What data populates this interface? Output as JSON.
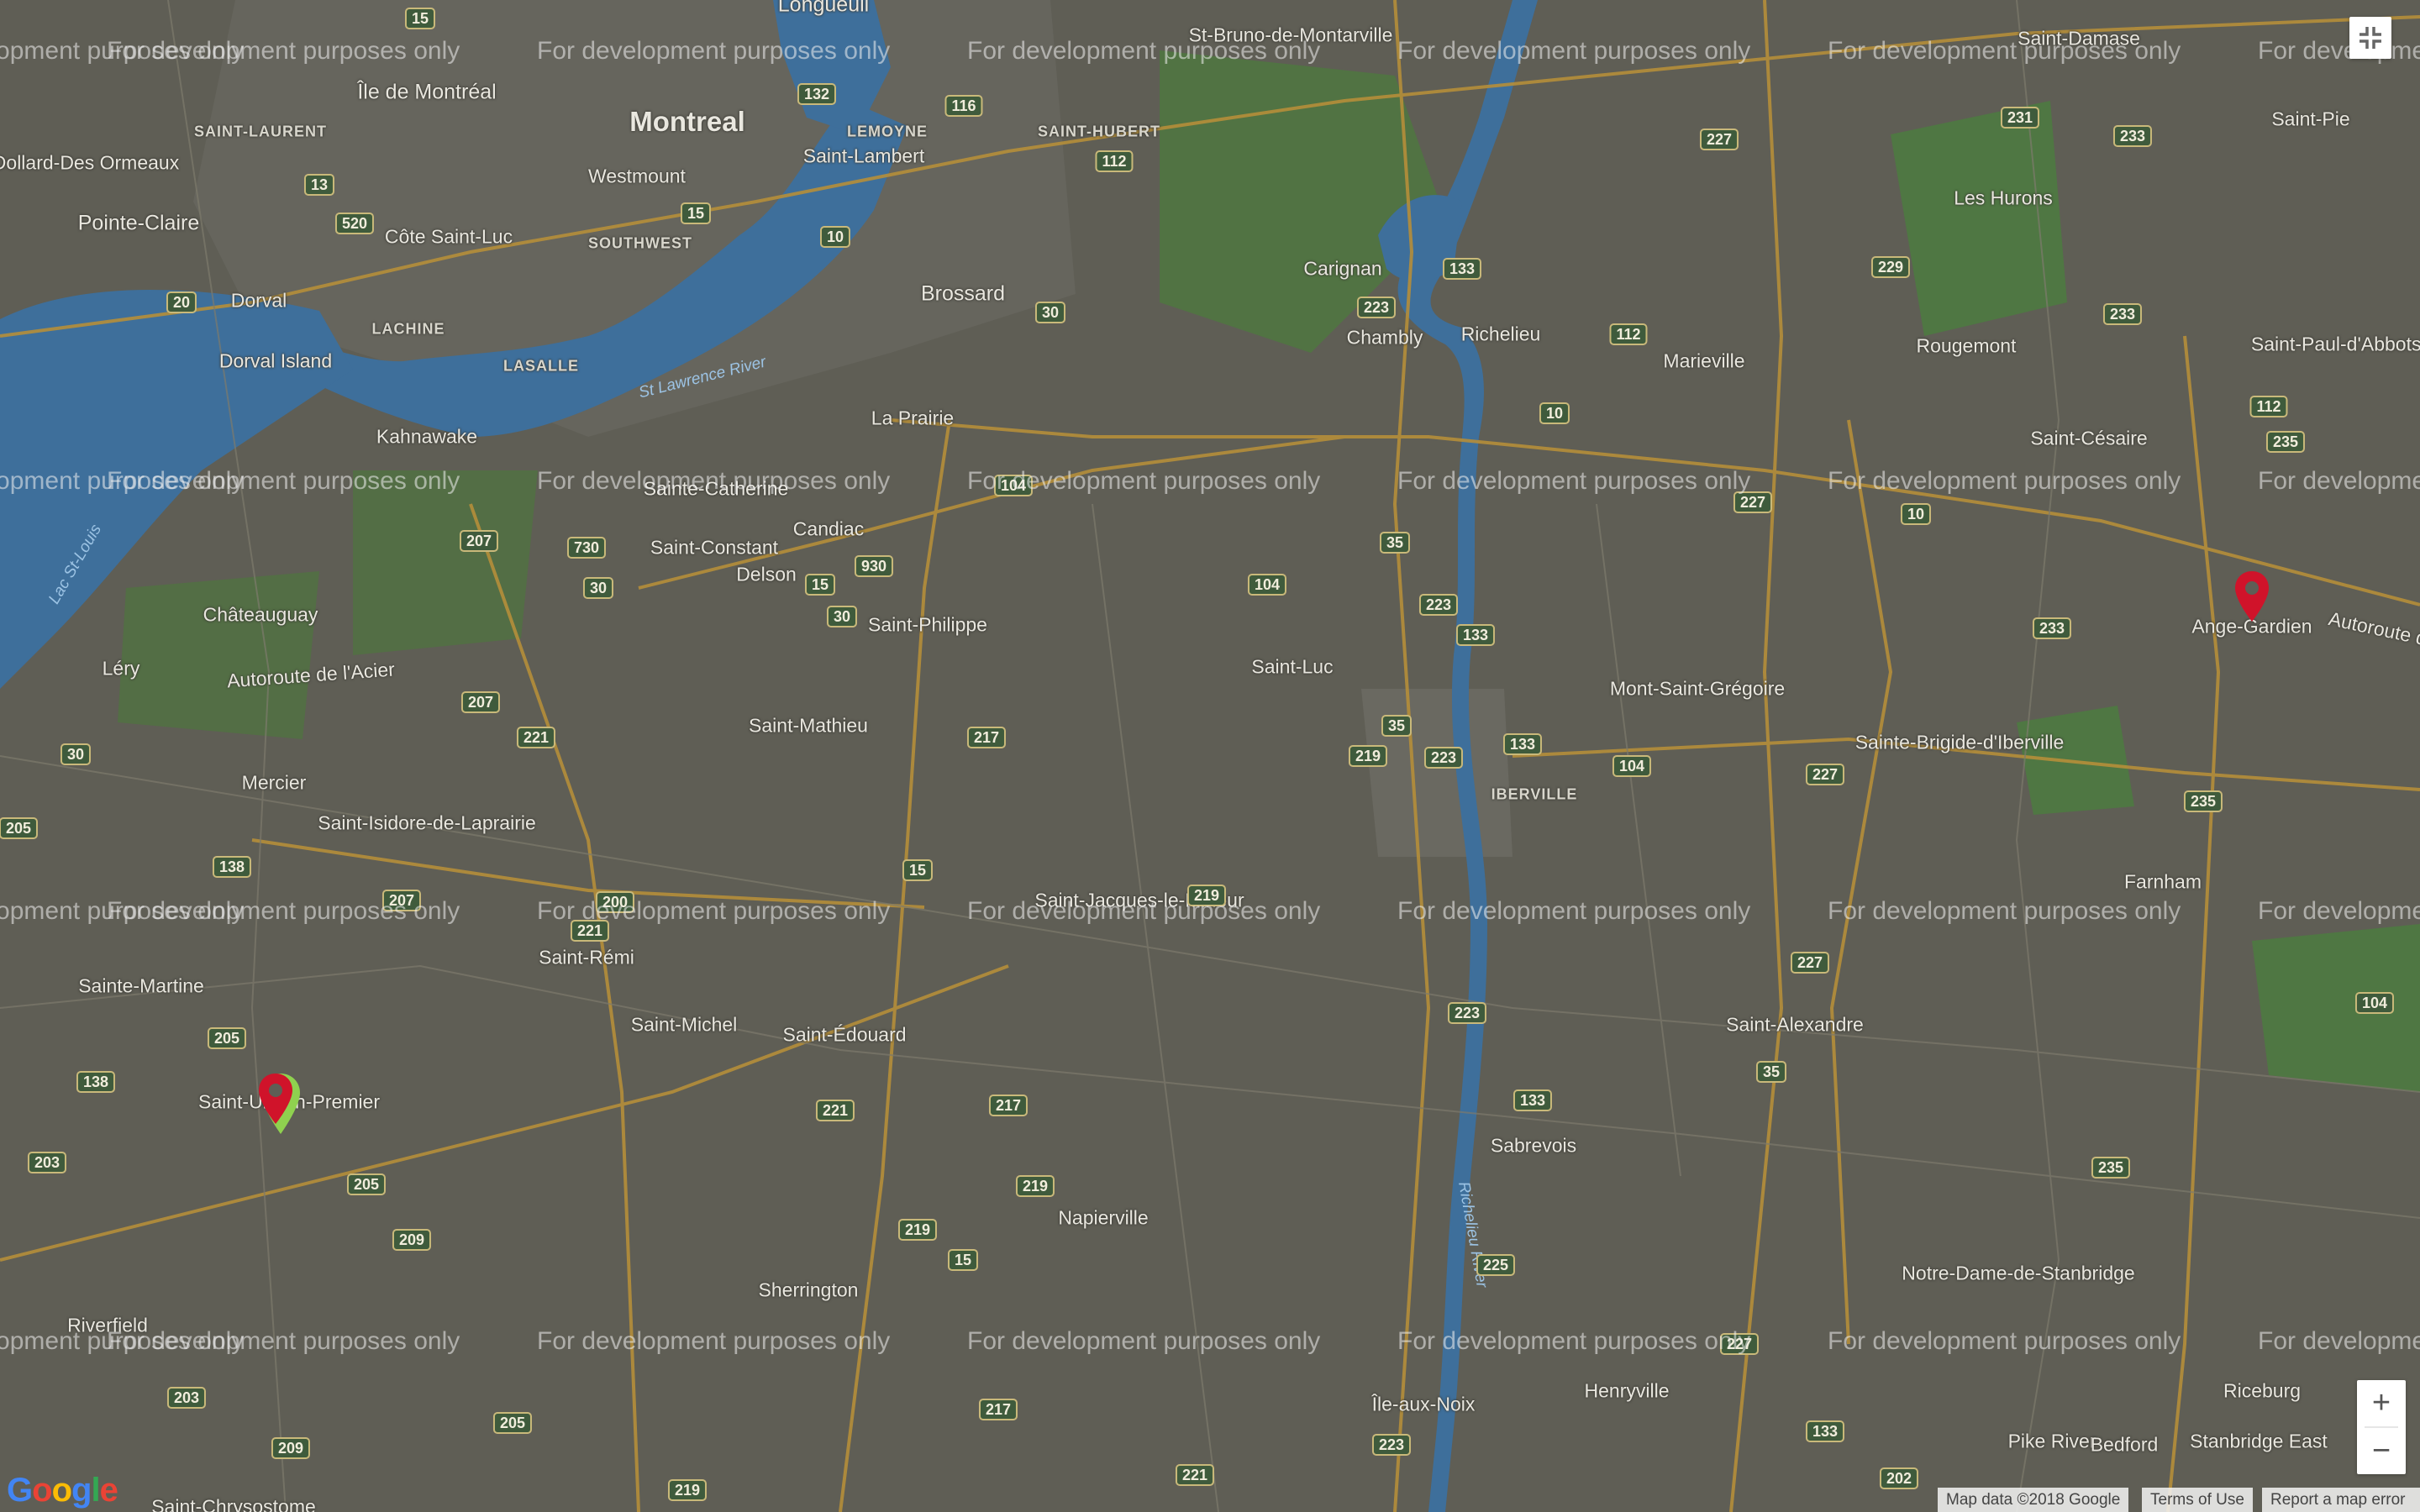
{
  "map": {
    "colors": {
      "land": "#5f5e55",
      "water": "#3e6f9b",
      "park": "#4d7a3f",
      "highway": "#b58e3a",
      "road": "#7d7a6c",
      "urban": "#6b6a62"
    },
    "places": [
      {
        "name": "Montreal",
        "style": "big"
      },
      {
        "name": "Longueuil",
        "style": "mid"
      },
      {
        "name": "Île de Montréal",
        "style": "mid"
      },
      {
        "name": "St-Bruno-de-Montarville",
        "style": "small"
      },
      {
        "name": "Saint-Damase",
        "style": "small"
      },
      {
        "name": "Saint-Pie",
        "style": "small"
      },
      {
        "name": "SAINT-LAURENT",
        "style": "caps"
      },
      {
        "name": "LEMOYNE",
        "style": "caps"
      },
      {
        "name": "SAINT-HUBERT",
        "style": "caps"
      },
      {
        "name": "Saint-Lambert",
        "style": "small"
      },
      {
        "name": "Dollard-Des Ormeaux",
        "style": "small"
      },
      {
        "name": "Westmount",
        "style": "small"
      },
      {
        "name": "Pointe-Claire",
        "style": "mid"
      },
      {
        "name": "Côte Saint-Luc",
        "style": "small"
      },
      {
        "name": "SOUTHWEST",
        "style": "caps"
      },
      {
        "name": "Les Hurons",
        "style": "small"
      },
      {
        "name": "Brossard",
        "style": "mid"
      },
      {
        "name": "Carignan",
        "style": "small"
      },
      {
        "name": "Dorval",
        "style": "small"
      },
      {
        "name": "LACHINE",
        "style": "caps"
      },
      {
        "name": "Chambly",
        "style": "small"
      },
      {
        "name": "Richelieu",
        "style": "small"
      },
      {
        "name": "Marieville",
        "style": "small"
      },
      {
        "name": "Rougemont",
        "style": "small"
      },
      {
        "name": "Saint-Paul-d'Abbotsford",
        "style": "small"
      },
      {
        "name": "Dorval Island",
        "style": "small"
      },
      {
        "name": "LASALLE",
        "style": "caps"
      },
      {
        "name": "La Prairie",
        "style": "small"
      },
      {
        "name": "Kahnawake",
        "style": "small"
      },
      {
        "name": "Sainte-Catherine",
        "style": "small"
      },
      {
        "name": "Saint-Césaire",
        "style": "small"
      },
      {
        "name": "Candiac",
        "style": "small"
      },
      {
        "name": "Saint-Constant",
        "style": "small"
      },
      {
        "name": "Delson",
        "style": "small"
      },
      {
        "name": "Ange-Gardien",
        "style": "small"
      },
      {
        "name": "Châteauguay",
        "style": "small"
      },
      {
        "name": "Saint-Philippe",
        "style": "small"
      },
      {
        "name": "Léry",
        "style": "small"
      },
      {
        "name": "Saint-Luc",
        "style": "small"
      },
      {
        "name": "Mont-Saint-Grégoire",
        "style": "small"
      },
      {
        "name": "Saint-Mathieu",
        "style": "small"
      },
      {
        "name": "Sainte-Brigide-d'Iberville",
        "style": "small"
      },
      {
        "name": "IBERVILLE",
        "style": "caps"
      },
      {
        "name": "Mercier",
        "style": "small"
      },
      {
        "name": "Saint-Isidore-de-Laprairie",
        "style": "small"
      },
      {
        "name": "Farnham",
        "style": "small"
      },
      {
        "name": "Saint-Jacques-le-Mineur",
        "style": "small"
      },
      {
        "name": "Saint-Rémi",
        "style": "small"
      },
      {
        "name": "Sainte-Martine",
        "style": "small"
      },
      {
        "name": "Saint-Michel",
        "style": "small"
      },
      {
        "name": "Saint-Édouard",
        "style": "small"
      },
      {
        "name": "Saint-Alexandre",
        "style": "small"
      },
      {
        "name": "Saint-Urbain-Premier",
        "style": "small"
      },
      {
        "name": "Sabrevois",
        "style": "small"
      },
      {
        "name": "Napierville",
        "style": "small"
      },
      {
        "name": "Notre-Dame-de-Stanbridge",
        "style": "small"
      },
      {
        "name": "Sherrington",
        "style": "small"
      },
      {
        "name": "Riverfield",
        "style": "small"
      },
      {
        "name": "Henryville",
        "style": "small"
      },
      {
        "name": "Île-aux-Noix",
        "style": "small"
      },
      {
        "name": "Riceburg",
        "style": "small"
      },
      {
        "name": "Pike River",
        "style": "small"
      },
      {
        "name": "Bedford",
        "style": "small"
      },
      {
        "name": "Stanbridge East",
        "style": "small"
      },
      {
        "name": "Saint-Chrysostome",
        "style": "small"
      },
      {
        "name": "St Lawrence River",
        "style": "water"
      },
      {
        "name": "Lac St-Louis",
        "style": "water"
      },
      {
        "name": "Richelieu River",
        "style": "water"
      },
      {
        "name": "Autoroute de l'Acier",
        "style": "small"
      },
      {
        "name": "Autoroute de",
        "style": "small"
      }
    ],
    "shields": [
      "15",
      "132",
      "116",
      "112",
      "227",
      "231",
      "233",
      "13",
      "520",
      "10",
      "15",
      "30",
      "223",
      "133",
      "229",
      "20",
      "112",
      "233",
      "10",
      "235",
      "112",
      "10",
      "207",
      "730",
      "30",
      "930",
      "15",
      "104",
      "30",
      "35",
      "227",
      "223",
      "133",
      "233",
      "104",
      "221",
      "207",
      "35",
      "219",
      "223",
      "133",
      "104",
      "227",
      "235",
      "30",
      "205",
      "138",
      "207",
      "200",
      "221",
      "15",
      "217",
      "219",
      "227",
      "205",
      "104",
      "223",
      "138",
      "35",
      "203",
      "221",
      "217",
      "133",
      "205",
      "209",
      "219",
      "219",
      "15",
      "225",
      "235",
      "203",
      "205",
      "209",
      "227",
      "133",
      "223",
      "217",
      "221",
      "202",
      "219"
    ],
    "watermark": "For development purposes only",
    "markers": [
      {
        "name": "red-marker",
        "color": "#d0132a"
      },
      {
        "name": "green-marker",
        "color": "#8fd14f"
      },
      {
        "name": "red-marker-east",
        "color": "#d0132a"
      }
    ]
  },
  "controls": {
    "fullscreen_icon": "fullscreen-exit-icon",
    "zoom_in": "+",
    "zoom_out": "−"
  },
  "attribution": {
    "map_data": "Map data ©2018 Google",
    "terms": "Terms of Use",
    "report": "Report a map error"
  },
  "logo": "Google"
}
